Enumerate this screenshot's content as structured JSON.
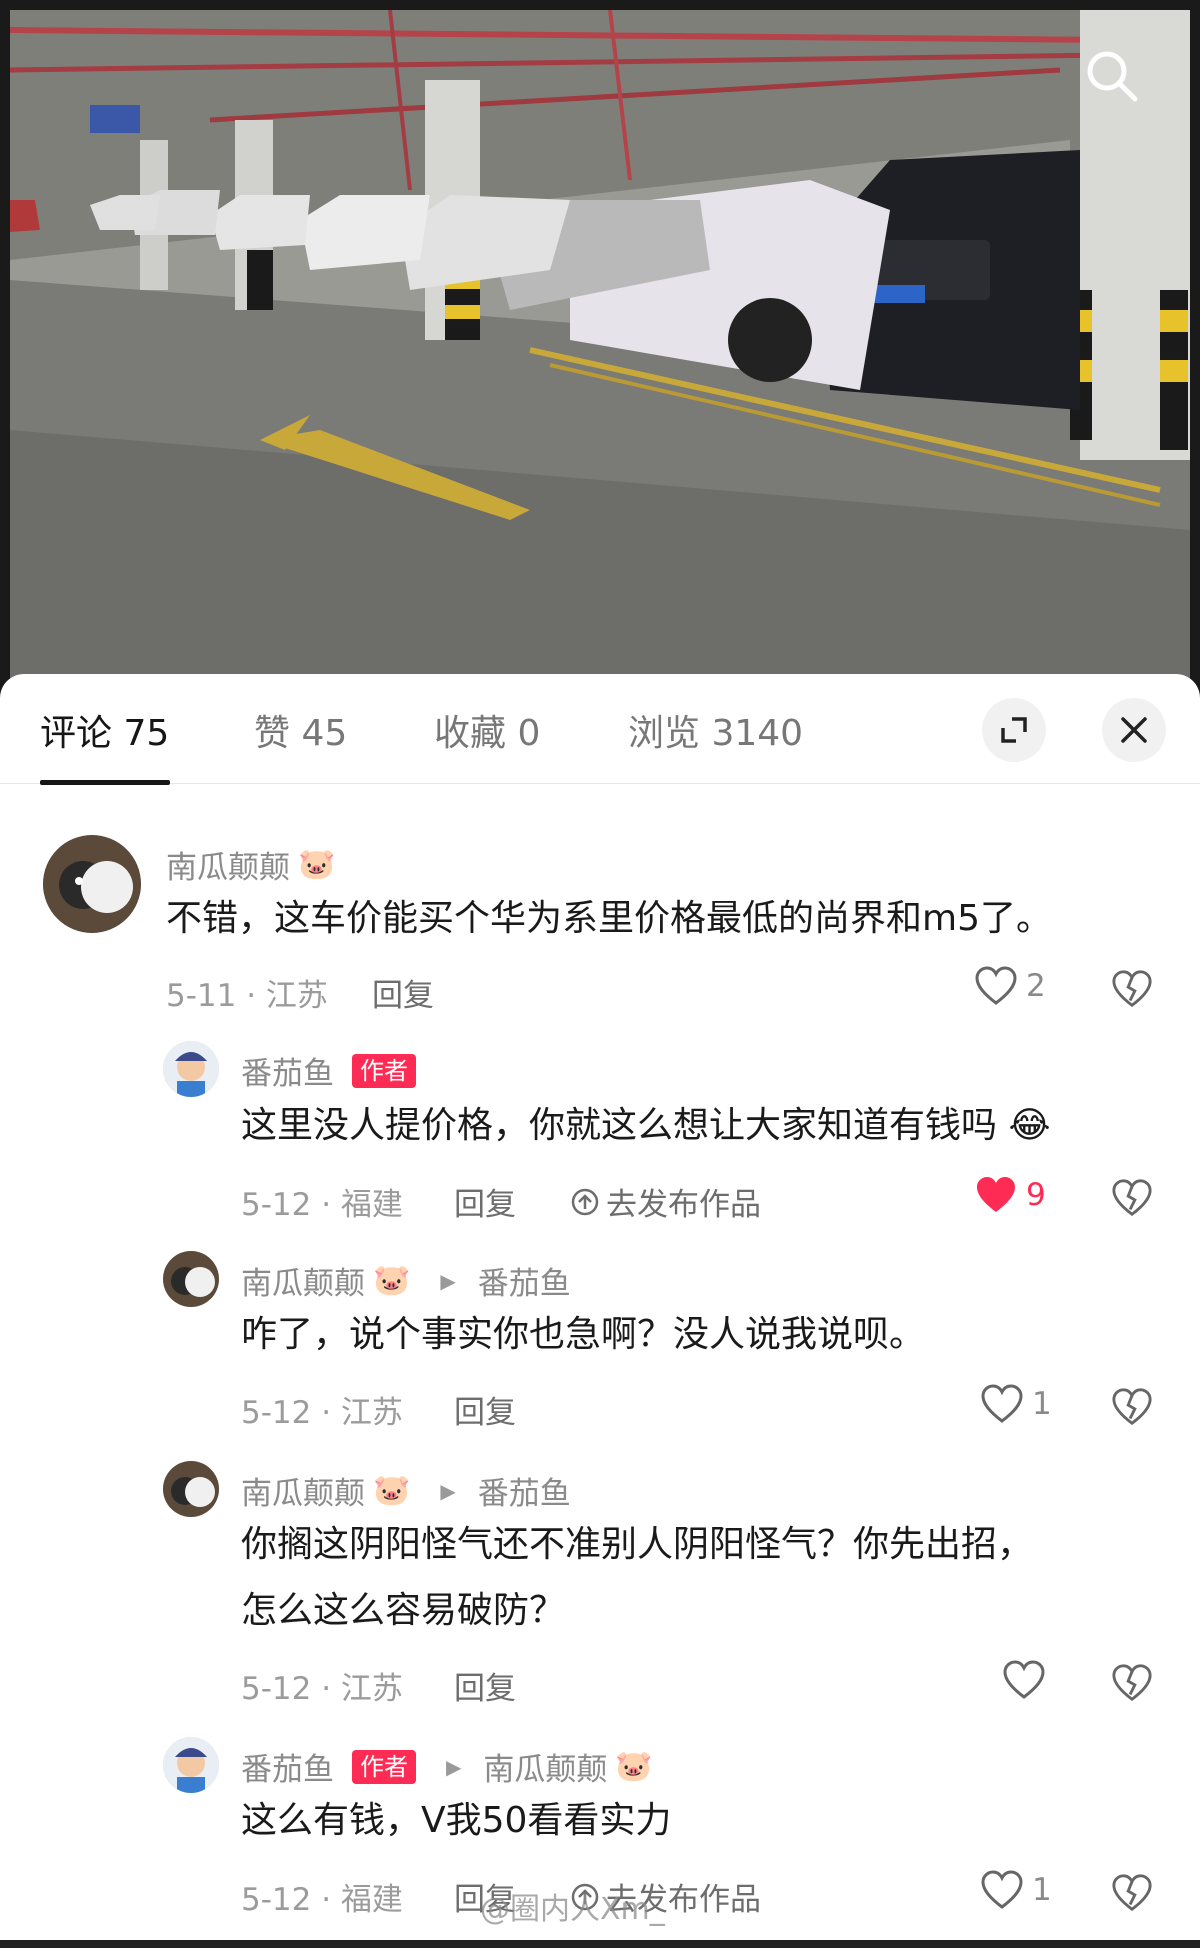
{
  "photo": {
    "description_icon": "parking-garage-photo",
    "search_icon": "search-icon"
  },
  "tabs": [
    {
      "label": "评论 75",
      "active": true
    },
    {
      "label": "赞 45",
      "active": false
    },
    {
      "label": "收藏 0",
      "active": false
    },
    {
      "label": "浏览 3140",
      "active": false
    }
  ],
  "header_buttons": {
    "expand_icon": "expand-icon",
    "close_icon": "close-icon"
  },
  "comments": [
    {
      "user": "南瓜颠颠",
      "user_emoji": "🐷",
      "text": "不错，这车价能买个华为系里价格最低的尚界和m5了。",
      "date": "5-11 · 江苏",
      "reply_label": "回复",
      "likes": "2",
      "liked": false
    },
    {
      "user": "番茄鱼",
      "author_tag": "作者",
      "text": "这里没人提价格，你就这么想让大家知道有钱吗 😂",
      "date": "5-12 · 福建",
      "reply_label": "回复",
      "publish_label": "去发布作品",
      "likes": "9",
      "liked": true
    },
    {
      "user": "南瓜颠颠",
      "user_emoji": "🐷",
      "reply_to": "番茄鱼",
      "text": "咋了，说个事实你也急啊？没人说我说呗。",
      "date": "5-12 · 江苏",
      "reply_label": "回复",
      "likes": "1",
      "liked": false
    },
    {
      "user": "南瓜颠颠",
      "user_emoji": "🐷",
      "reply_to": "番茄鱼",
      "text_line1": "你搁这阴阳怪气还不准别人阴阳怪气？你先出招，",
      "text_line2": "怎么这么容易破防？",
      "date": "5-12 · 江苏",
      "reply_label": "回复",
      "likes": "",
      "liked": false
    },
    {
      "user": "番茄鱼",
      "author_tag": "作者",
      "reply_to": "南瓜颠颠",
      "reply_to_emoji": "🐷",
      "text": "这么有钱，V我50看看实力",
      "date": "5-12 · 福建",
      "reply_label": "回复",
      "publish_label": "去发布作品",
      "likes": "1",
      "liked": false
    }
  ],
  "watermark": "@圈内人Xm_"
}
